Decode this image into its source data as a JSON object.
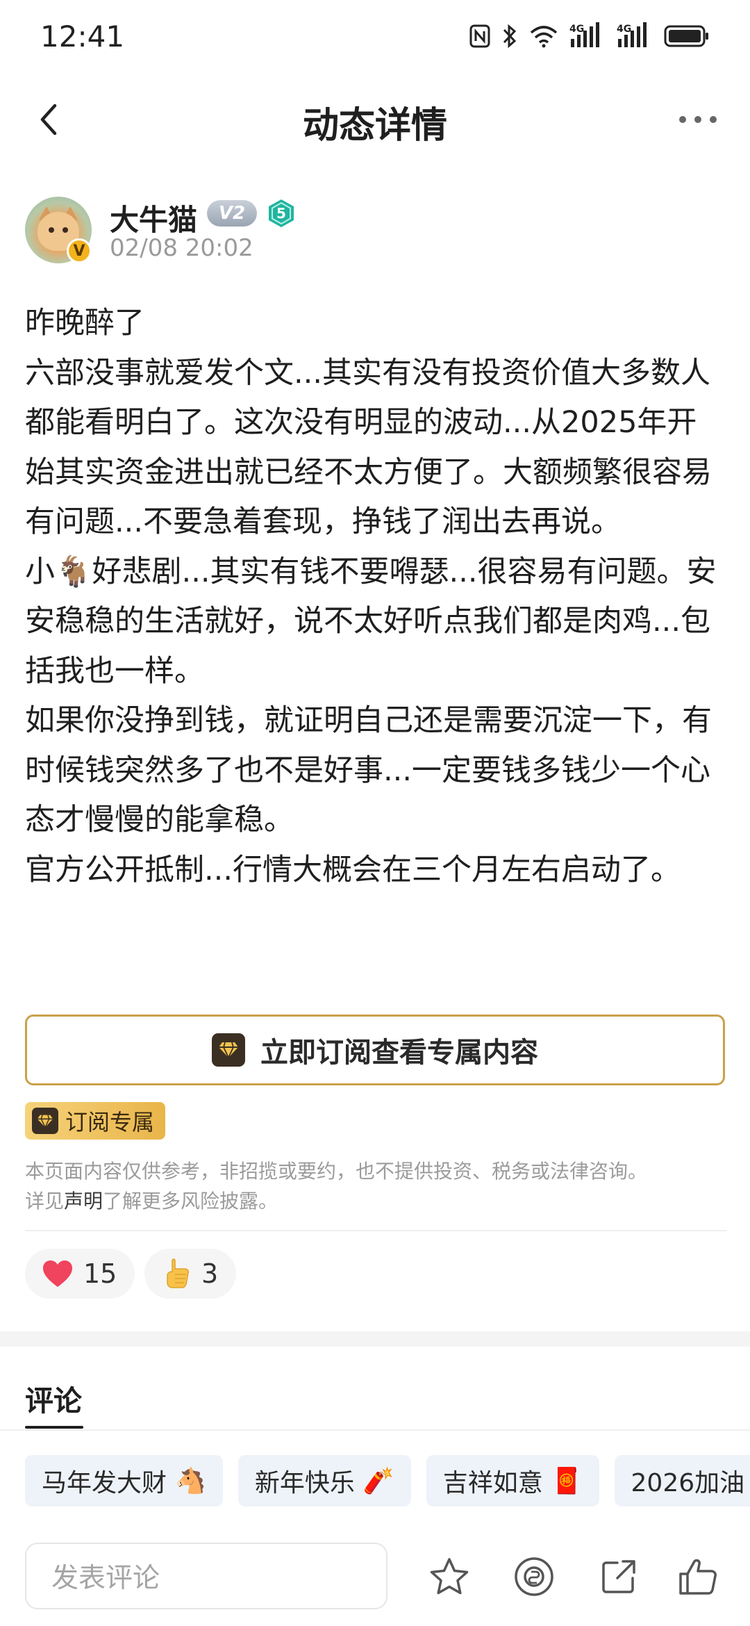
{
  "status_bar": {
    "time": "12:41",
    "signal_1_label": "4G",
    "signal_2_label": "4G"
  },
  "nav": {
    "title": "动态详情"
  },
  "author": {
    "name": "大牛猫",
    "level_tag": "V2",
    "rank_badge": "5",
    "verified_badge": "V",
    "time": "02/08 20:02"
  },
  "post": {
    "text": "昨晚醉了\n六部没事就爱发个文...其实有没有投资价值大多数人都能看明白了。这次没有明显的波动...从2025年开始其实资金进出就已经不太方便了。大额频繁很容易有问题...不要急着套现，挣钱了润出去再说。\n小🐐好悲剧...其实有钱不要嘚瑟...很容易有问题。安安稳稳的生活就好，说不太好听点我们都是肉鸡...包括我也一样。\n如果你没挣到钱，就证明自己还是需要沉淀一下，有时候钱突然多了也不是好事...一定要钱多钱少一个心态才慢慢的能拿稳。\n官方公开抵制...行情大概会在三个月左右启动了。"
  },
  "subscribe": {
    "button_label": "立即订阅查看专属内容",
    "tag_label": "订阅专属"
  },
  "disclaimer": {
    "line1": "本页面内容仅供参考，非招揽或要约，也不提供投资、税务或法律咨询。",
    "prefix": "详见",
    "link": "声明",
    "suffix": "了解更多风险披露。"
  },
  "reactions": {
    "heart_count": "15",
    "thumb_count": "3"
  },
  "comments": {
    "tab_label": "评论",
    "chips": [
      {
        "label": "马年发大财",
        "emoji": "🐴"
      },
      {
        "label": "新年快乐",
        "emoji": "🧨"
      },
      {
        "label": "吉祥如意",
        "emoji": "🧧"
      },
      {
        "label": "2026加油",
        "emoji": ""
      }
    ],
    "input_placeholder": "发表评论"
  },
  "colors": {
    "gold_border": "#c9a14b",
    "heart": "#f0435d",
    "rank_badge": "#21b5a0"
  }
}
